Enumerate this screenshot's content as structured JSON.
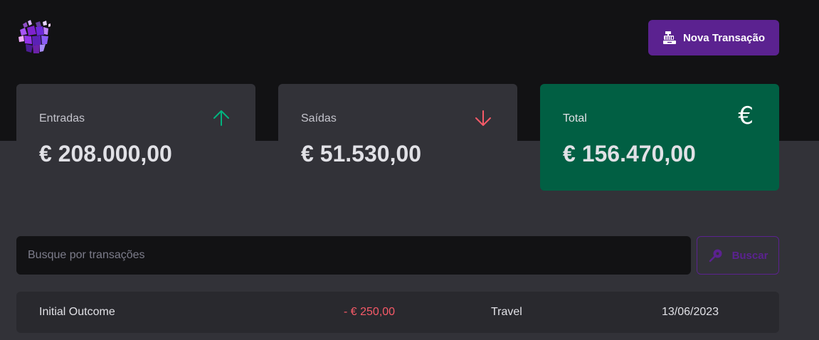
{
  "header": {
    "logo_icon": "ignite-logo-icon",
    "new_transaction_label": "Nova Transação",
    "new_transaction_icon": "cash-register-icon"
  },
  "summary": {
    "income": {
      "label": "Entradas",
      "value": "€ 208.000,00",
      "icon": "arrow-up-icon",
      "icon_color": "#00b37e"
    },
    "outcome": {
      "label": "Saídas",
      "value": "€ 51.530,00",
      "icon": "arrow-down-icon",
      "icon_color": "#f75a68"
    },
    "total": {
      "label": "Total",
      "value": "€ 156.470,00",
      "icon": "euro-icon",
      "icon_glyph": "€",
      "background": "#015f43"
    }
  },
  "search": {
    "placeholder": "Busque por transações",
    "value": "",
    "button_label": "Buscar",
    "button_icon": "search-icon"
  },
  "transactions": [
    {
      "description": "Initial Outcome",
      "price": "- € 250,00",
      "category": "Travel",
      "date": "13/06/2023"
    }
  ],
  "colors": {
    "brand": "#5b2290",
    "income": "#00b37e",
    "outcome": "#f75a68",
    "total_card": "#015f43",
    "header_bg": "#121214",
    "page_bg": "#323238"
  }
}
